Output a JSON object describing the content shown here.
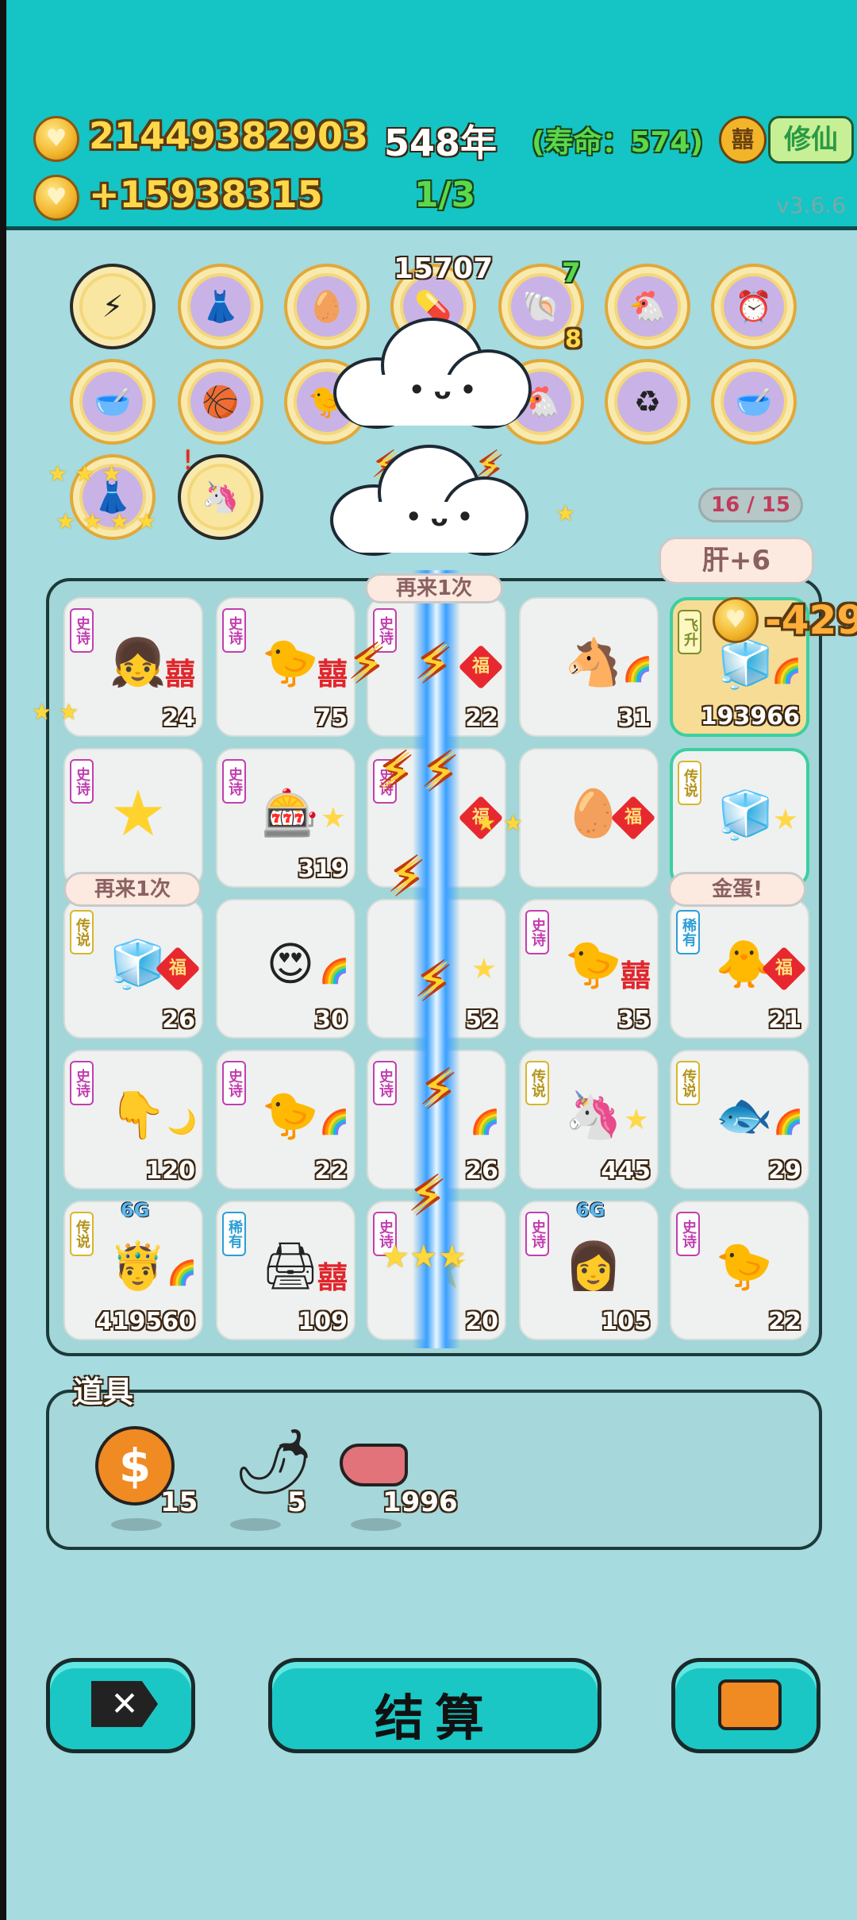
{
  "header": {
    "coins_total": "21449382903",
    "coins_rate": "+15938315",
    "years": "548年",
    "lifespan": "(寿命：574)",
    "round": "1/3",
    "xiuxian_label": "修仙",
    "version": "v3.6.6",
    "chest_icon": "囍"
  },
  "relics": {
    "counter_a": "15707",
    "counter_b": "7",
    "counter_c": "8",
    "progress": "16 / 15"
  },
  "bubbles": {
    "liver": "肝+6",
    "again": "再来1次",
    "again_top": "再来1次",
    "golden_egg": "金蛋!",
    "coin_delta": "-429"
  },
  "grid": {
    "rows": [
      [
        {
          "tag": "史诗",
          "num": "24",
          "icon": "girl-with-hat-icon",
          "side": "囍"
        },
        {
          "tag": "史诗",
          "num": "75",
          "icon": "grey-hair-bird-icon",
          "side": "囍"
        },
        {
          "tag": "史诗",
          "num": "22",
          "icon": "bird-icon",
          "side": "福"
        },
        {
          "tag": "",
          "num": "31",
          "icon": "horse-icon",
          "side": "rainbow"
        },
        {
          "tag": "飞升",
          "num": "193966",
          "icon": "fridge-icon",
          "side": "rainbow"
        }
      ],
      [
        {
          "tag": "史诗",
          "num": "",
          "icon": "star-burst-icon",
          "side": ""
        },
        {
          "tag": "史诗",
          "num": "319",
          "icon": "gacha-machine-icon",
          "side": "star"
        },
        {
          "tag": "史诗",
          "num": "",
          "icon": "egg-icon",
          "side": "福"
        },
        {
          "tag": "",
          "num": "",
          "icon": "golden-egg-icon",
          "side": "福"
        },
        {
          "tag": "传说",
          "num": "",
          "icon": "fridge-icon",
          "side": "star"
        }
      ],
      [
        {
          "tag": "传说",
          "num": "26",
          "icon": "fridge-icon",
          "side": "福"
        },
        {
          "tag": "",
          "num": "30",
          "icon": "man-face-icon",
          "side": "rainbow"
        },
        {
          "tag": "",
          "num": "52",
          "icon": "face-icon",
          "side": "star"
        },
        {
          "tag": "史诗",
          "num": "35",
          "icon": "grey-hair-bird-icon",
          "side": "囍"
        },
        {
          "tag": "稀有",
          "num": "21",
          "icon": "chick-icon",
          "side": "福"
        }
      ],
      [
        {
          "tag": "史诗",
          "num": "120",
          "icon": "pointing-hand-icon",
          "side": "moon"
        },
        {
          "tag": "史诗",
          "num": "22",
          "icon": "grey-hair-bird-icon",
          "side": "rainbow"
        },
        {
          "tag": "史诗",
          "num": "26",
          "icon": "bird-icon",
          "side": "rainbow"
        },
        {
          "tag": "传说",
          "num": "445",
          "icon": "unicorn-icon",
          "side": "star"
        },
        {
          "tag": "传说",
          "num": "29",
          "icon": "koi-fish-icon",
          "side": "rainbow"
        }
      ],
      [
        {
          "tag": "传说",
          "num": "419560",
          "icon": "king-face-icon",
          "side": "rainbow",
          "gen": "6G"
        },
        {
          "tag": "稀有",
          "num": "109",
          "icon": "printer-icon",
          "side": "囍"
        },
        {
          "tag": "史诗",
          "num": "20",
          "icon": "star-pile-icon",
          "side": ""
        },
        {
          "tag": "史诗",
          "num": "105",
          "icon": "girl-braids-icon",
          "side": "",
          "gen": "6G"
        },
        {
          "tag": "史诗",
          "num": "22",
          "icon": "grey-hair-bird-icon",
          "side": ""
        }
      ]
    ]
  },
  "tools": {
    "title": "道具",
    "items": [
      {
        "icon": "coin-dollar-icon",
        "count": "15"
      },
      {
        "icon": "chili-pepper-icon",
        "count": "5"
      },
      {
        "icon": "liver-icon",
        "count": "1996"
      }
    ]
  },
  "buttons": {
    "settle_label": "结算"
  },
  "colors": {
    "header_bg": "#15c4c4",
    "page_bg": "#a6dbe0",
    "button_bg": "#1bc7c4",
    "gold": "#ffd84a"
  }
}
